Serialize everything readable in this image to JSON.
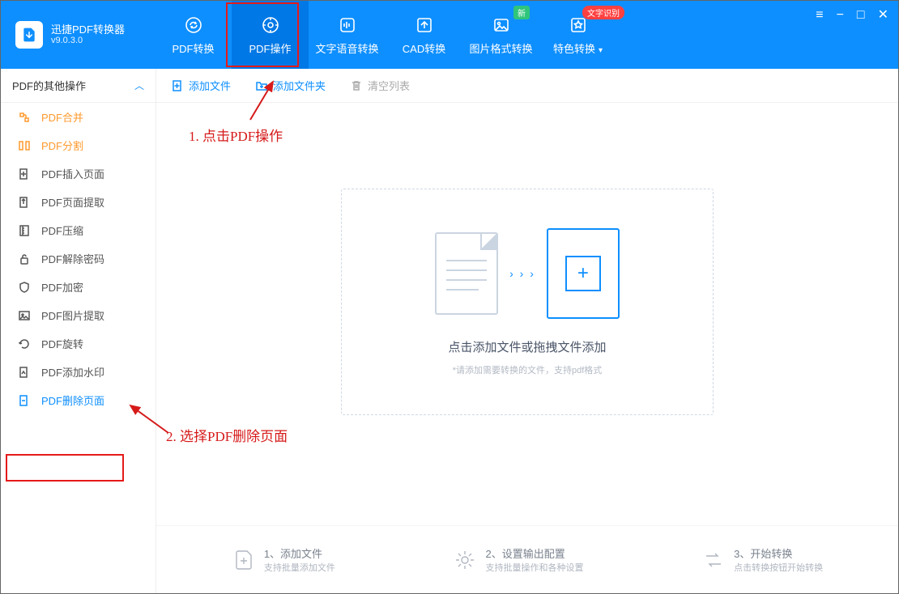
{
  "app": {
    "name": "迅捷PDF转换器",
    "version": "v9.0.3.0"
  },
  "nav": [
    {
      "label": "PDF转换"
    },
    {
      "label": "PDF操作"
    },
    {
      "label": "文字语音转换"
    },
    {
      "label": "CAD转换"
    },
    {
      "label": "图片格式转换",
      "badge_new": "新"
    },
    {
      "label": "特色转换",
      "badge_text": "文字识别"
    }
  ],
  "sidebar": {
    "header": "PDF的其他操作",
    "items": [
      {
        "label": "PDF合并"
      },
      {
        "label": "PDF分割"
      },
      {
        "label": "PDF插入页面"
      },
      {
        "label": "PDF页面提取"
      },
      {
        "label": "PDF压缩"
      },
      {
        "label": "PDF解除密码"
      },
      {
        "label": "PDF加密"
      },
      {
        "label": "PDF图片提取"
      },
      {
        "label": "PDF旋转"
      },
      {
        "label": "PDF添加水印"
      },
      {
        "label": "PDF删除页面"
      }
    ]
  },
  "toolbar": {
    "add_file": "添加文件",
    "add_folder": "添加文件夹",
    "clear_list": "清空列表"
  },
  "dropzone": {
    "title": "点击添加文件或拖拽文件添加",
    "sub": "*请添加需要转换的文件，支持pdf格式"
  },
  "steps": [
    {
      "t1": "1、添加文件",
      "t2": "支持批量添加文件"
    },
    {
      "t1": "2、设置输出配置",
      "t2": "支持批量操作和各种设置"
    },
    {
      "t1": "3、开始转换",
      "t2": "点击转换按钮开始转换"
    }
  ],
  "annotations": {
    "a1": "1. 点击PDF操作",
    "a2": "2. 选择PDF删除页面"
  }
}
